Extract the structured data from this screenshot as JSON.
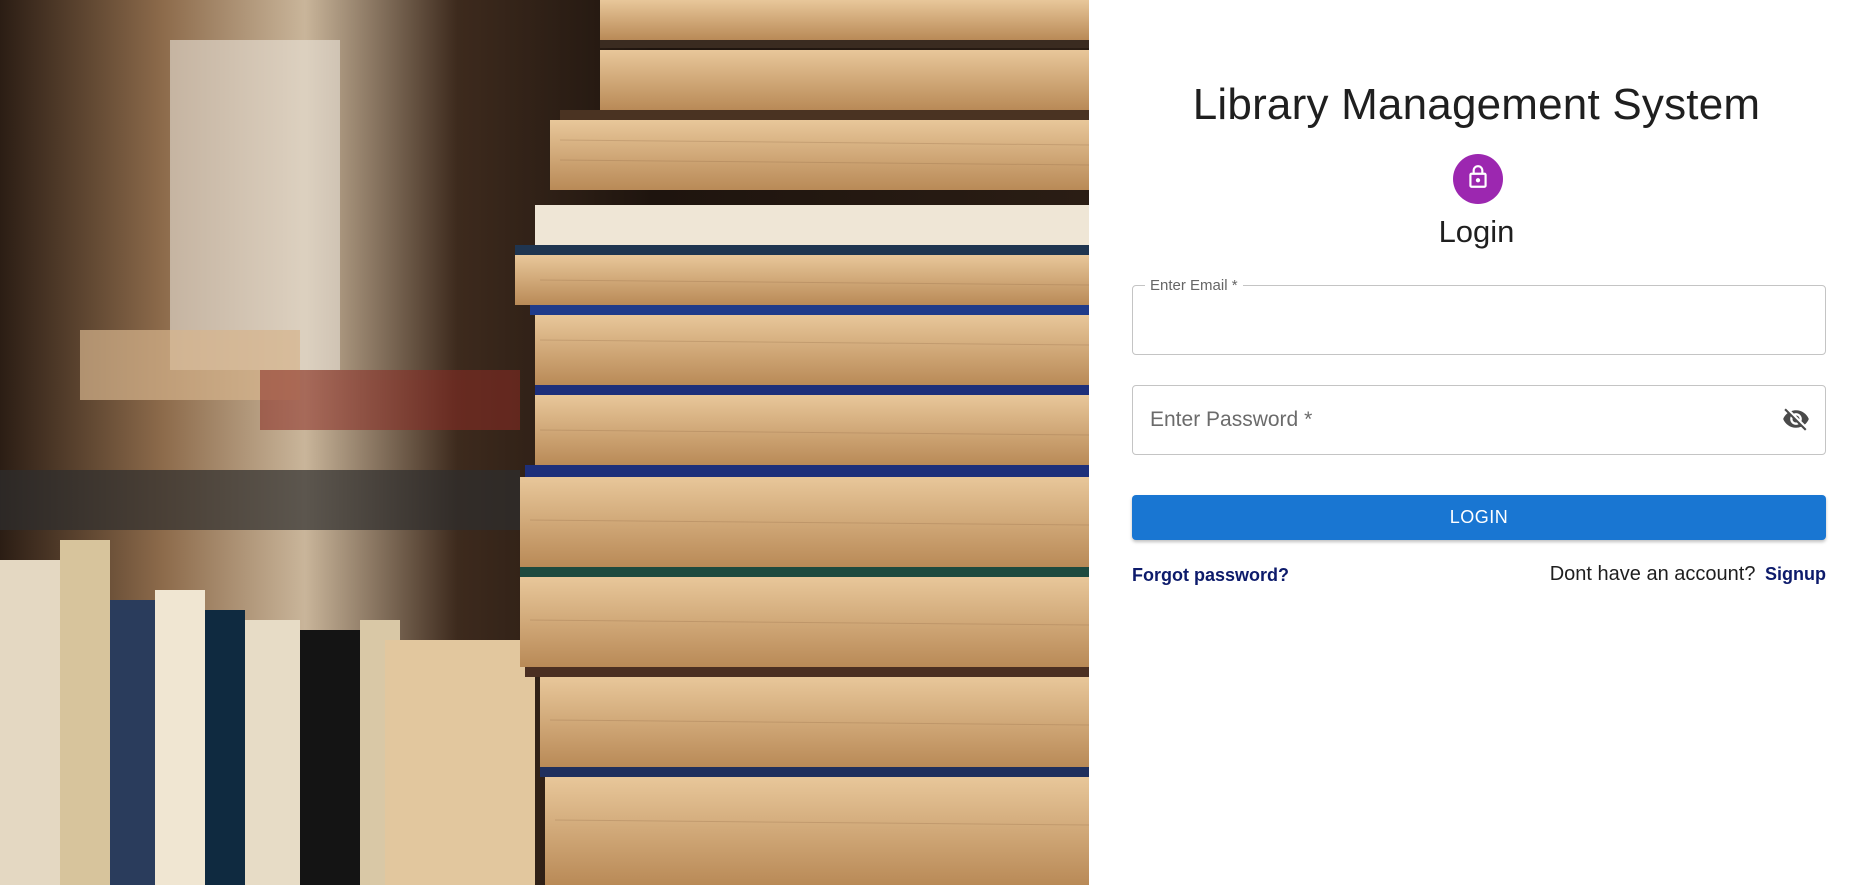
{
  "app": {
    "title": "Library Management System"
  },
  "form": {
    "heading": "Login",
    "email": {
      "label": "Enter Email *",
      "value": ""
    },
    "password": {
      "placeholder": "Enter Password *",
      "value": "",
      "toggle_icon": "eye-off-icon"
    },
    "submit_label": "LOGIN",
    "forgot_label": "Forgot password?",
    "signup_prompt": "Dont have an account?",
    "signup_label": "Signup"
  },
  "colors": {
    "avatar": "#9c27b0",
    "primary_button": "#1976d2",
    "link": "#0d1b6b"
  },
  "icons": {
    "avatar": "lock-icon"
  }
}
